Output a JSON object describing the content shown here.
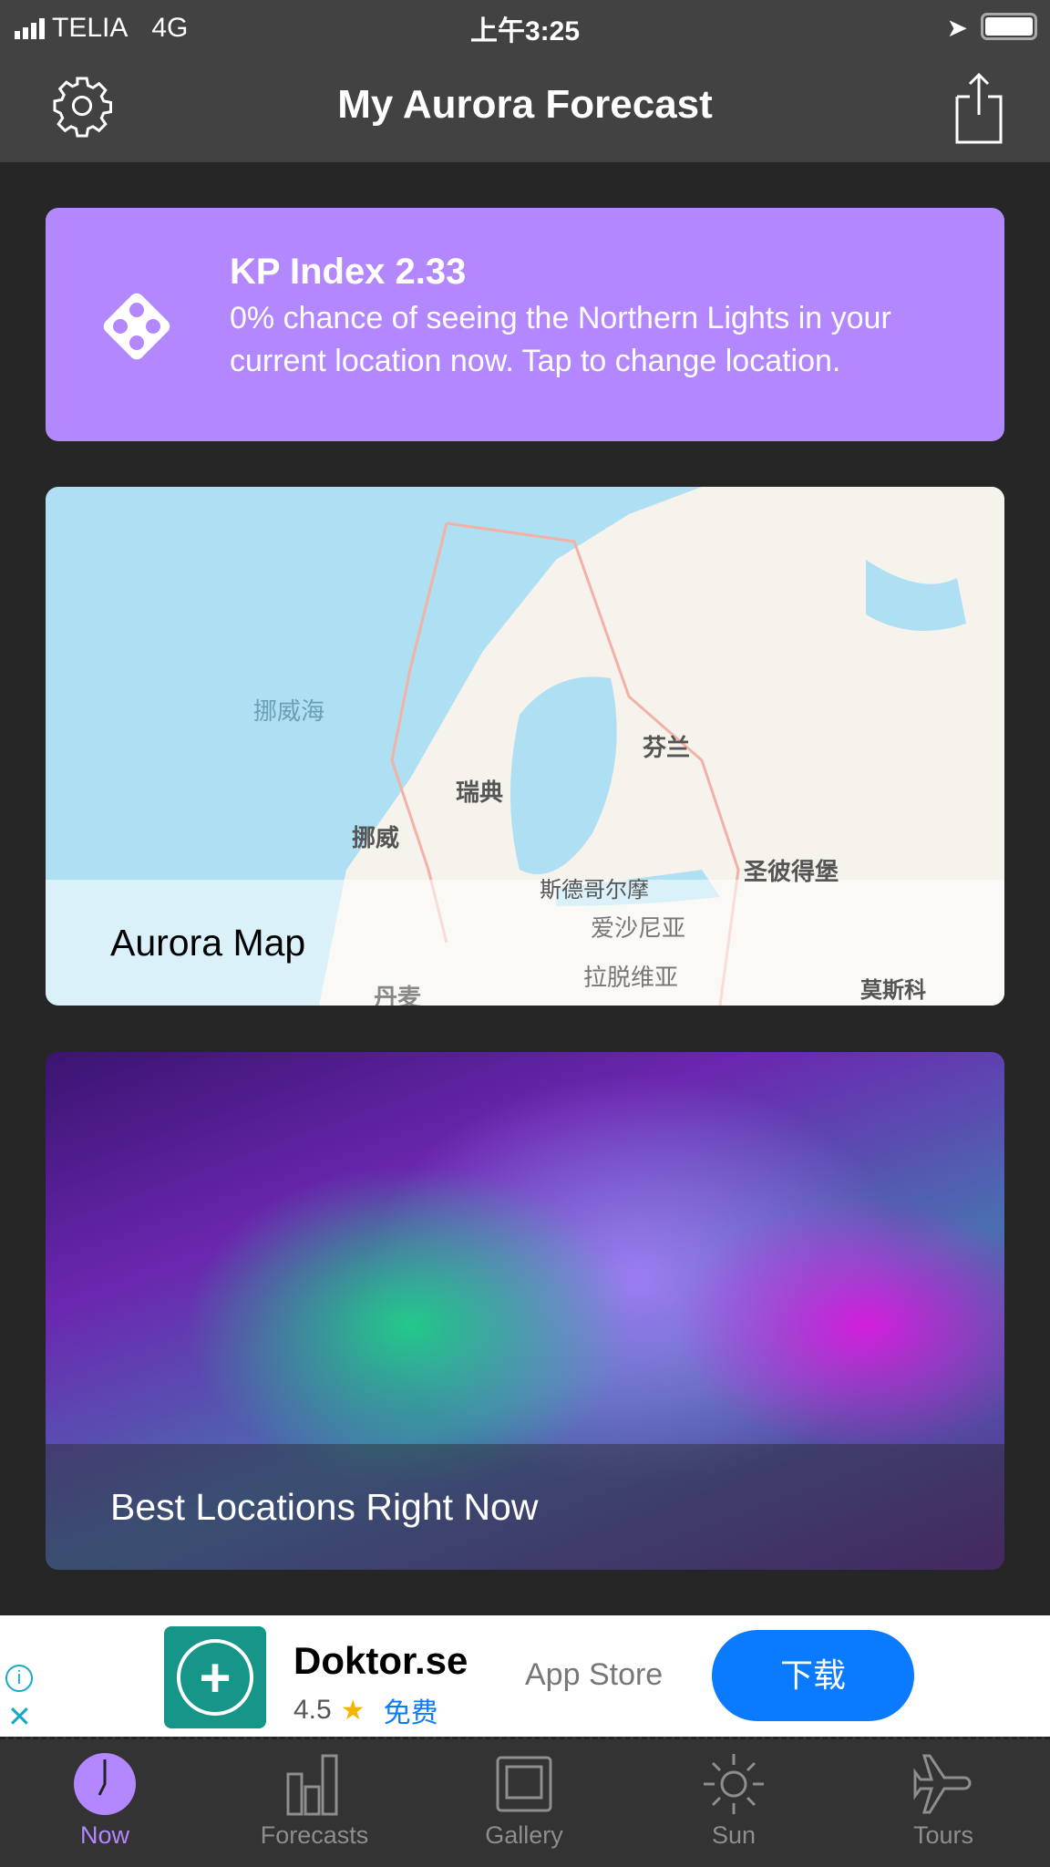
{
  "status": {
    "carrier": "TELIA",
    "network": "4G",
    "time": "上午3:25"
  },
  "header": {
    "title": "My Aurora Forecast",
    "settings_icon": "gear-icon",
    "share_icon": "share-icon"
  },
  "kp_card": {
    "title": "KP Index 2.33",
    "description": "0% chance of seeing the Northern Lights in your current location now. Tap to change location.",
    "icon": "dice-icon",
    "color": "#b388fe"
  },
  "map_card": {
    "label": "Aurora Map",
    "places": [
      "挪威海",
      "瑞典",
      "挪威",
      "芬兰",
      "斯德哥尔摩",
      "圣彼得堡",
      "爱沙尼亚",
      "拉脱维亚",
      "莫斯科",
      "丹麦"
    ]
  },
  "locations_card": {
    "label": "Best Locations Right Now"
  },
  "ad": {
    "app_name": "Doktor.se",
    "rating": "4.5",
    "price": "免费",
    "store": "App Store",
    "cta": "下载",
    "cta_color": "#0a7bff"
  },
  "tabs": [
    {
      "label": "Now",
      "active": true
    },
    {
      "label": "Forecasts"
    },
    {
      "label": "Gallery"
    },
    {
      "label": "Sun"
    },
    {
      "label": "Tours"
    }
  ],
  "accent": "#b388fe"
}
